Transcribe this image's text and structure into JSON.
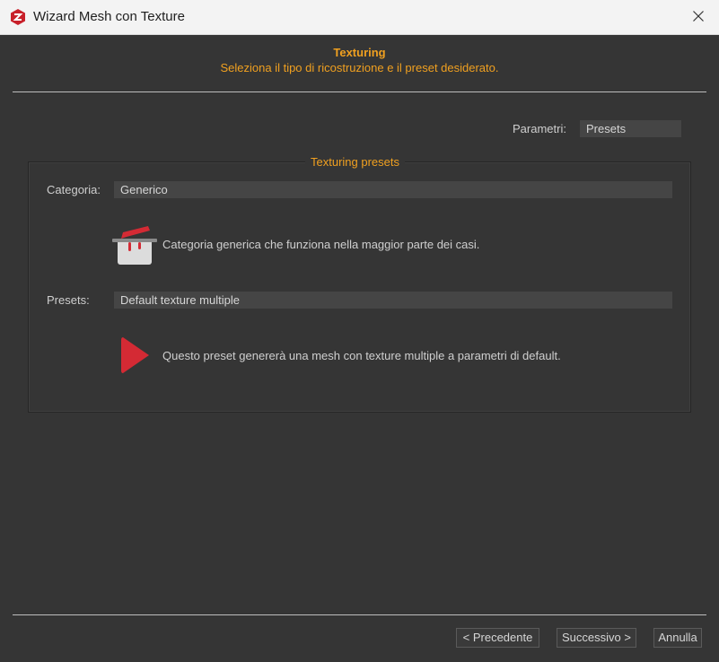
{
  "window": {
    "title": "Wizard Mesh con Texture",
    "app_icon": "app-logo-icon",
    "close_icon": "close-icon"
  },
  "header": {
    "title": "Texturing",
    "subtitle": "Seleziona il tipo di ricostruzione e il preset desiderato."
  },
  "parameters": {
    "label": "Parametri:",
    "value": "Presets"
  },
  "group": {
    "title": "Texturing presets",
    "category": {
      "label": "Categoria:",
      "value": "Generico",
      "icon": "pot-icon",
      "description": "Categoria generica che funziona nella maggior parte dei casi."
    },
    "preset": {
      "label": "Presets:",
      "value": "Default texture multiple",
      "icon": "play-triangle-icon",
      "description": "Questo preset genererà una mesh con texture multiple a parametri di default."
    }
  },
  "footer": {
    "back_label": "< Precedente",
    "next_label": "Successivo >",
    "cancel_label": "Annulla"
  },
  "colors": {
    "accent": "#f0a020",
    "background": "#353535",
    "icon_red": "#d42a34"
  }
}
